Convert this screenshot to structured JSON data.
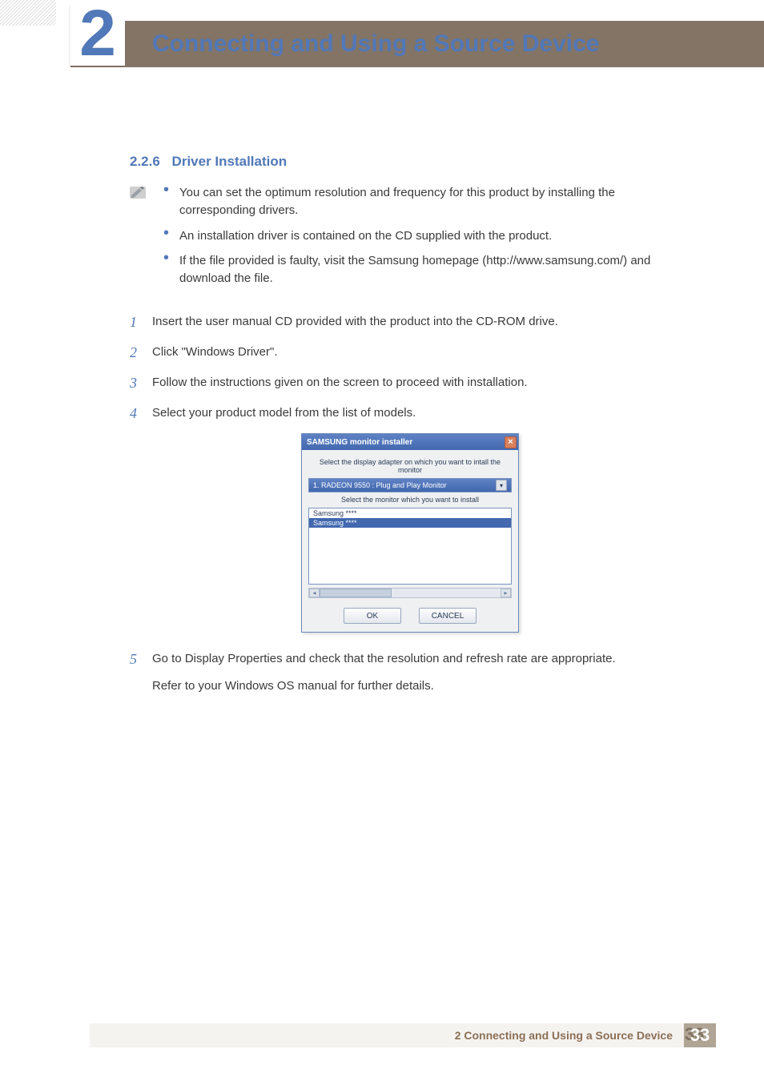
{
  "chapter": {
    "number": "2",
    "title": "Connecting and Using a Source Device"
  },
  "section": {
    "number": "2.2.6",
    "title": "Driver Installation"
  },
  "notes": [
    "You can set the optimum resolution and frequency for this product by installing the corresponding drivers.",
    "An installation driver is contained on the CD supplied with the product.",
    "If the file provided is faulty, visit the Samsung homepage (http://www.samsung.com/) and download the file."
  ],
  "steps": [
    "Insert the user manual CD provided with the product into the CD-ROM drive.",
    "Click \"Windows Driver\".",
    "Follow the instructions given on the screen to proceed with installation.",
    "Select your product model from the list of models.",
    "Go to Display Properties and check that the resolution and refresh rate are appropriate."
  ],
  "step5_extra": "Refer to your Windows OS manual for further details.",
  "dialog": {
    "title": "SAMSUNG monitor installer",
    "label1": "Select the display adapter on which you want to intall the monitor",
    "select_value": "1. RADEON 9550 : Plug and Play Monitor",
    "label2": "Select the monitor which you want to install",
    "list_item_1": "Samsung ****",
    "list_item_2": "Samsung ****",
    "ok": "OK",
    "cancel": "CANCEL"
  },
  "footer": {
    "text": "2 Connecting and Using a Source Device",
    "page": "33"
  }
}
